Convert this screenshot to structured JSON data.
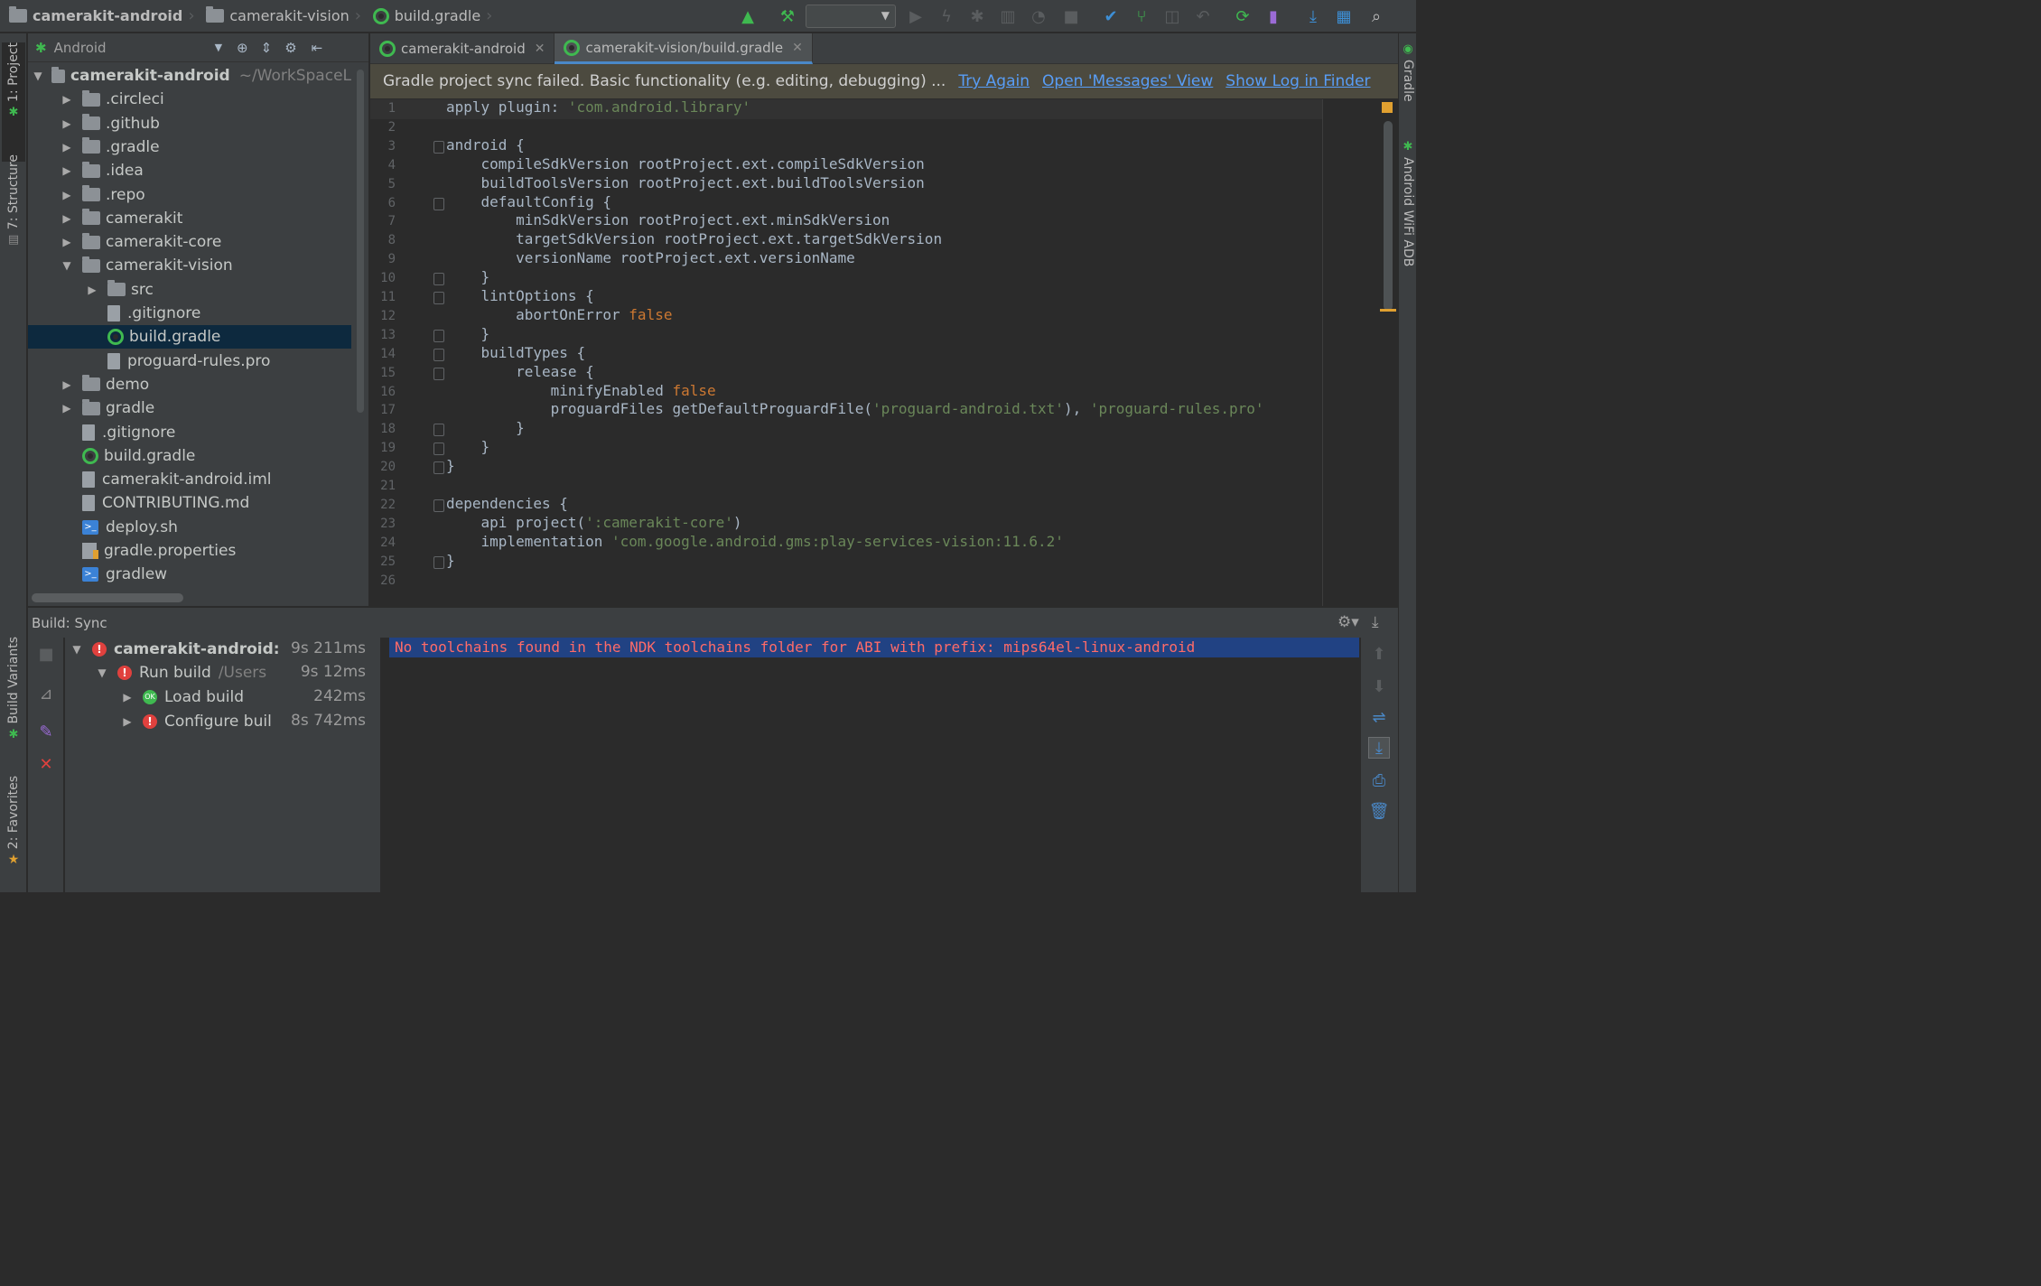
{
  "breadcrumbs": [
    "camerakit-android",
    "camerakit-vision",
    "build.gradle"
  ],
  "toolwindows_left": {
    "project": "1: Project",
    "structure": "7: Structure",
    "build_variants": "Build Variants",
    "favorites": "2: Favorites"
  },
  "toolwindows_right": {
    "gradle": "Gradle",
    "wifi_adb": "Android WiFi ADB"
  },
  "project_panel": {
    "view_selector": "Android"
  },
  "tree": [
    {
      "label": "camerakit-android",
      "hint": "~/WorkSpaceL",
      "type": "folder",
      "depth": 0,
      "expanded": true,
      "bold": true
    },
    {
      "label": ".circleci",
      "type": "folder",
      "depth": 1,
      "expanded": false
    },
    {
      "label": ".github",
      "type": "folder",
      "depth": 1,
      "expanded": false
    },
    {
      "label": ".gradle",
      "type": "folder",
      "depth": 1,
      "expanded": false
    },
    {
      "label": ".idea",
      "type": "folder",
      "depth": 1,
      "expanded": false
    },
    {
      "label": ".repo",
      "type": "folder",
      "depth": 1,
      "expanded": false
    },
    {
      "label": "camerakit",
      "type": "folder",
      "depth": 1,
      "expanded": false
    },
    {
      "label": "camerakit-core",
      "type": "folder",
      "depth": 1,
      "expanded": false
    },
    {
      "label": "camerakit-vision",
      "type": "folder",
      "depth": 1,
      "expanded": true
    },
    {
      "label": "src",
      "type": "folder",
      "depth": 2,
      "expanded": false
    },
    {
      "label": ".gitignore",
      "type": "file",
      "depth": 2
    },
    {
      "label": "build.gradle",
      "type": "gradle",
      "depth": 2,
      "selected": true
    },
    {
      "label": "proguard-rules.pro",
      "type": "file",
      "depth": 2
    },
    {
      "label": "demo",
      "type": "folder",
      "depth": 1,
      "expanded": false
    },
    {
      "label": "gradle",
      "type": "folder",
      "depth": 1,
      "expanded": false
    },
    {
      "label": ".gitignore",
      "type": "file",
      "depth": 1
    },
    {
      "label": "build.gradle",
      "type": "gradle",
      "depth": 1
    },
    {
      "label": "camerakit-android.iml",
      "type": "file",
      "depth": 1
    },
    {
      "label": "CONTRIBUTING.md",
      "type": "file",
      "depth": 1
    },
    {
      "label": "deploy.sh",
      "type": "shell",
      "depth": 1
    },
    {
      "label": "gradle.properties",
      "type": "properties",
      "depth": 1
    },
    {
      "label": "gradlew",
      "type": "shell",
      "depth": 1
    }
  ],
  "editor_tabs": [
    {
      "label": "camerakit-android",
      "active": false
    },
    {
      "label": "camerakit-vision/build.gradle",
      "active": true
    }
  ],
  "banner": {
    "message": "Gradle project sync failed. Basic functionality (e.g. editing, debugging) ...",
    "links": [
      "Try Again",
      "Open 'Messages' View",
      "Show Log in Finder"
    ]
  },
  "code_lines": [
    "apply plugin: 'com.android.library'",
    "",
    "android {",
    "    compileSdkVersion rootProject.ext.compileSdkVersion",
    "    buildToolsVersion rootProject.ext.buildToolsVersion",
    "    defaultConfig {",
    "        minSdkVersion rootProject.ext.minSdkVersion",
    "        targetSdkVersion rootProject.ext.targetSdkVersion",
    "        versionName rootProject.ext.versionName",
    "    }",
    "    lintOptions {",
    "        abortOnError false",
    "    }",
    "    buildTypes {",
    "        release {",
    "            minifyEnabled false",
    "            proguardFiles getDefaultProguardFile('proguard-android.txt'), 'proguard-rules.pro'",
    "        }",
    "    }",
    "}",
    "",
    "dependencies {",
    "    api project(':camerakit-core')",
    "    implementation 'com.google.android.gms:play-services-vision:11.6.2'",
    "}",
    ""
  ],
  "build_panel": {
    "title": "Build: Sync",
    "tree": [
      {
        "label": "camerakit-android:",
        "duration": "9s 211ms",
        "status": "error",
        "depth": 0,
        "bold": true
      },
      {
        "label": "Run build",
        "sub": "/Users",
        "duration": "9s 12ms",
        "status": "error",
        "depth": 1
      },
      {
        "label": "Load build",
        "duration": "242ms",
        "status": "ok",
        "depth": 2
      },
      {
        "label": "Configure buil",
        "duration": "8s 742ms",
        "status": "error",
        "depth": 2
      }
    ],
    "error_message": "No toolchains found in the NDK toolchains folder for ABI with prefix: mips64el-linux-android"
  },
  "colors": {
    "accent": "#4a88c7",
    "error": "#e0413e",
    "ok": "#3fb950",
    "error_text": "#ff6b68",
    "link": "#589df6"
  }
}
